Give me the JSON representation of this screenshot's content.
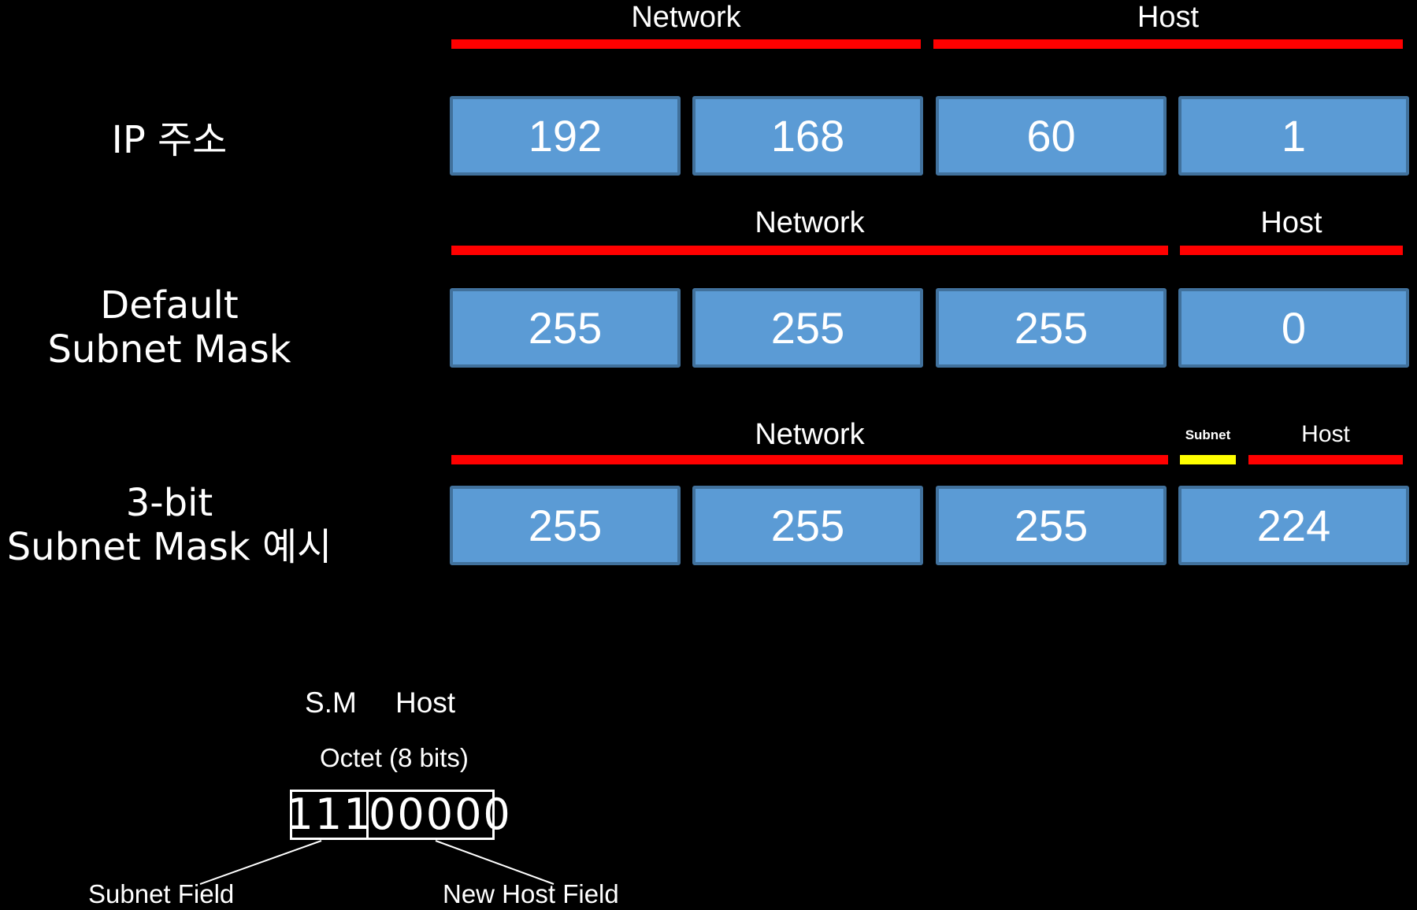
{
  "colors": {
    "background": "#000000",
    "network_bar": "#ff0000",
    "host_bar": "#ff0000",
    "subnet_bar": "#ffff00",
    "octet_fill": "#5b9bd5",
    "octet_border": "#41719c",
    "text": "#ffffff"
  },
  "rows": [
    {
      "label_lines": [
        "IP 주소"
      ],
      "segments": [
        {
          "label": "Network",
          "color": "#ff0000"
        },
        {
          "label": "Host",
          "color": "#ff0000"
        }
      ],
      "octets": [
        "192",
        "168",
        "60",
        "1"
      ]
    },
    {
      "label_lines": [
        "Default",
        "Subnet Mask"
      ],
      "segments": [
        {
          "label": "Network",
          "color": "#ff0000"
        },
        {
          "label": "Host",
          "color": "#ff0000"
        }
      ],
      "octets": [
        "255",
        "255",
        "255",
        "0"
      ]
    },
    {
      "label_lines": [
        "3-bit",
        "Subnet Mask 예시"
      ],
      "segments": [
        {
          "label": "Network",
          "color": "#ff0000"
        },
        {
          "label": "Subnet",
          "color": "#ffff00"
        },
        {
          "label": "Host",
          "color": "#ff0000"
        }
      ],
      "octets": [
        "255",
        "255",
        "255",
        "224"
      ]
    }
  ],
  "octet_detail": {
    "sm_label": "S.M",
    "host_label": "Host",
    "title": "Octet (8 bits)",
    "subnet_bits": "111",
    "host_bits": "00000",
    "subnet_field_label": "Subnet Field",
    "new_host_field_label": "New Host Field"
  }
}
